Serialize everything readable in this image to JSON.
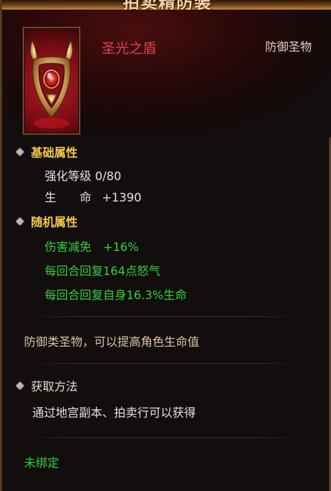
{
  "window": {
    "title": "拍卖精防装"
  },
  "item": {
    "name": "圣光之盾",
    "type": "防御圣物",
    "icon": "holy-shield-icon"
  },
  "basic": {
    "header": "基础属性",
    "enhance_label": "强化等级",
    "enhance_value": "0/80",
    "hp_label": "生　　命",
    "hp_value": "+1390"
  },
  "random": {
    "header": "随机属性",
    "lines": [
      "伤害减免　+16%",
      "每回合回复164点怒气",
      "每回合回复自身16.3%生命"
    ]
  },
  "description": "防御类圣物，可以提高角色生命值",
  "acquire": {
    "header": "获取方法",
    "text": "通过地宫副本、拍卖行可以获得"
  },
  "binding": "未绑定",
  "colors": {
    "name": "#d9434a",
    "attribute_header": "#f0c64a",
    "random_attr": "#2fd23a",
    "description": "#d9c3a2"
  }
}
